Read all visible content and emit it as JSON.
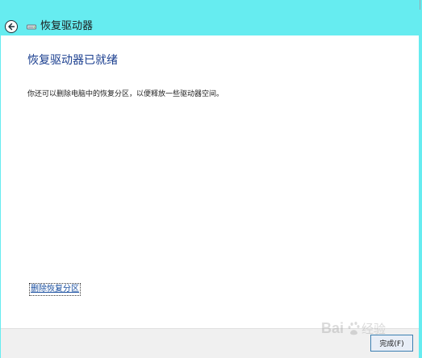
{
  "window": {
    "title": "恢复驱动器",
    "background_color": "#66ecf0"
  },
  "titlebar": {
    "back_icon": "back-arrow-icon",
    "drive_icon": "drive-icon"
  },
  "main": {
    "heading": "恢复驱动器已就绪",
    "description": "你还可以删除电脑中的恢复分区，以便释放一些驱动器空间。",
    "delete_link_label": "删除恢复分区",
    "heading_color": "#1a3e8f"
  },
  "footer": {
    "finish_button_label": "完成(F)"
  }
}
